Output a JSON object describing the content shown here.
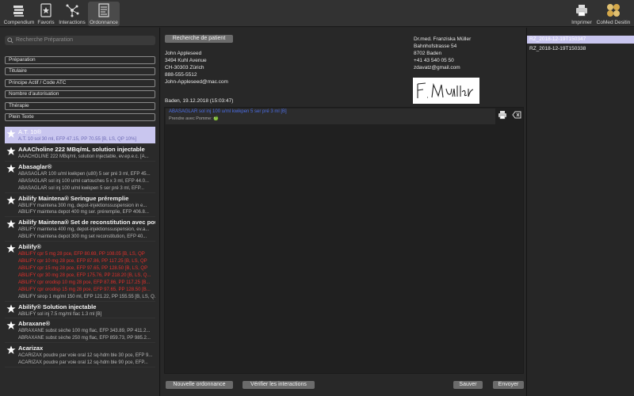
{
  "toolbar": {
    "compendium": "Compendium",
    "favoris": "Favoris",
    "interactions": "Interactions",
    "ordonnance": "Ordonnance",
    "imprimer": "Imprimer",
    "comed": "CoMed Desitin"
  },
  "search": {
    "placeholder": "Recherche Préparation"
  },
  "filters": [
    "Préparation",
    "Titulaire",
    "Principe Actif / Code ATC",
    "Nombre d'autorisation",
    "Thérapie",
    "Plein Texte"
  ],
  "products": [
    {
      "name": "A.T. 10®",
      "lines": [
        "A.T. 10 sol 30 ml, EFP 47.15, PP 70.55 [B, LS, QP 10%]"
      ]
    },
    {
      "name": "AAACholine 222 MBq/mL solution injectable",
      "lines": [
        "AAACHOLINE 222 MBq/ml, solution injectable, ev.ep.e.c. [A..."
      ]
    },
    {
      "name": "Abasaglar®",
      "lines": [
        "ABASAGLAR 100 u/ml kwikpen (u80) 5 ser pré 3 ml, EFP 45...",
        "ABASAGLAR sol inj 100 u/ml cartouches 5 x 3 ml, EFP 44.0...",
        "ABASAGLAR sol inj 100 u/ml kwikpen 5 ser pré 3 ml, EFP..."
      ]
    },
    {
      "name": "Abilify Maintena® Seringue préremplie",
      "lines": [
        "ABILIFY maintena 300 mg, depot-injektionssuspension in e...",
        "ABILIFY maintena depot 400 mg ser. préremplie, EFP 406.8..."
      ]
    },
    {
      "name": "Abilify Maintena® Set de reconstitution avec pou",
      "lines": [
        "ABILIFY maintena 400 mg, depot-injektionssuspension, ev.a...",
        "ABILIFY maintena depot 300 mg set reconstitution, EFP 40..."
      ]
    },
    {
      "name": "Abilify®",
      "lines": [
        "ABILIFY cpr 5 mg 28 pce, EFP 80.69, PP 108.05 [B, LS, QP",
        "ABILIFY cpr 10 mg 28 pce, EFP 87.86, PP 117.25 [B, LS, QP",
        "ABILIFY cpr 15 mg 28 pce, EFP 97.65, PP 128.50 [B, LS, QP",
        "ABILIFY cpr 30 mg 28 pce, EFP 175.76, PP 218.20 [B, LS, Q...",
        "ABILIFY cpr orodisp 10 mg 28 pce, EFP 87.86, PP 117.25 [B...",
        "ABILIFY cpr orodisp 15 mg 28 pce, EFP 97.65, PP 128.50 [B...",
        "ABILIFY sirop 1 mg/ml 150 ml, EFP 121.22, PP 155.55 [B, LS, Q..."
      ],
      "red": [
        0,
        1,
        2,
        3,
        4,
        5
      ]
    },
    {
      "name": "Abilify® Solution injectable",
      "lines": [
        "ABILIFY sol inj 7.5 mg/ml flac 1.3 ml [B]"
      ]
    },
    {
      "name": "Abraxane®",
      "lines": [
        "ABRAXANE subst sèche 100 mg flac, EFP 343.89, PP 411.2...",
        "ABRAXANE subst sèche 250 mg flac, EFP 859.73, PP 985.2..."
      ]
    },
    {
      "name": "Acarizax",
      "lines": [
        "ACARIZAX poudre par voie oral 12 sq-hdm ble 30 pce, EFP 9...",
        "ACARIZAX poudre par voie oral 12 sq-hdm ble 90 pce, EFP..."
      ]
    }
  ],
  "patient": {
    "search_button": "Recherche de patient",
    "name": "John Appleseed",
    "street": "3494 Kuhl Avenue",
    "city": "CH-30303 Zürich",
    "phone": "888-555-5512",
    "email": "John-Appleseed@mac.com",
    "date": "Baden, 19.12.2018 (15:03:47)"
  },
  "doctor": {
    "name": "Dr.med. Franziska Müller",
    "street": "Bahnhofstrasse 54",
    "city": "8702 Baden",
    "phone": "+41 43 540 05 50",
    "email": "zdavatz@gmail.com",
    "signature": "F. Müller"
  },
  "prescription": {
    "item": "ABASAGLAR sol inj 100 u/ml kwikpen 5 ser pré 3 ml [B]",
    "note": "Prendre avec Pomme: 🍏"
  },
  "buttons": {
    "nouvelle": "Nouvelle ordonnance",
    "verifier": "Vérifier les interactions",
    "sauver": "Sauver",
    "envoyer": "Envoyer"
  },
  "files": [
    "RZ_2018-12-19T150347",
    "RZ_2018-12-19T150338"
  ],
  "colors": {
    "selection": "#c9c6ef",
    "prescription_blue": "#4c6ee6",
    "warning_red": "#e2302b"
  }
}
